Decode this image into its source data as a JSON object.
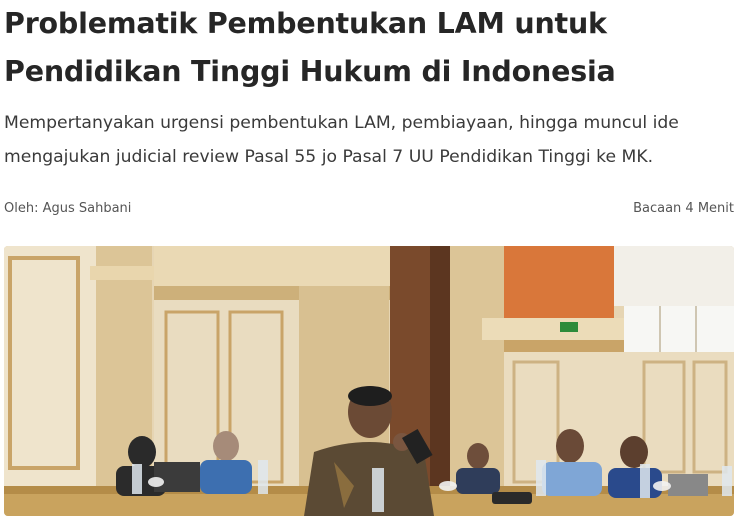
{
  "article": {
    "title_line1": "Problematik Pembentukan LAM untuk",
    "title_line2": "Pendidikan Tinggi Hukum di Indonesia",
    "subtitle_line1": "Mempertanyakan urgensi pembentukan LAM, pembiayaan, hingga muncul ide",
    "subtitle_line2": "mengajukan judicial review Pasal 55 jo Pasal 7 UU Pendidikan Tinggi ke MK.",
    "author": "Oleh: Agus Sahbani",
    "read_time": "Bacaan 4 Menit"
  },
  "colors": {
    "title": "#262626",
    "text": "#3a3a3a",
    "meta": "#555555",
    "wall": "#e8d8b8",
    "pillar": "#d9c39a",
    "orange_wall": "#d9773a",
    "exit_sign": "#2e8b3a"
  },
  "photo": {
    "subject": "hero-photo-seminar-meeting",
    "exit_sign_text": ""
  }
}
